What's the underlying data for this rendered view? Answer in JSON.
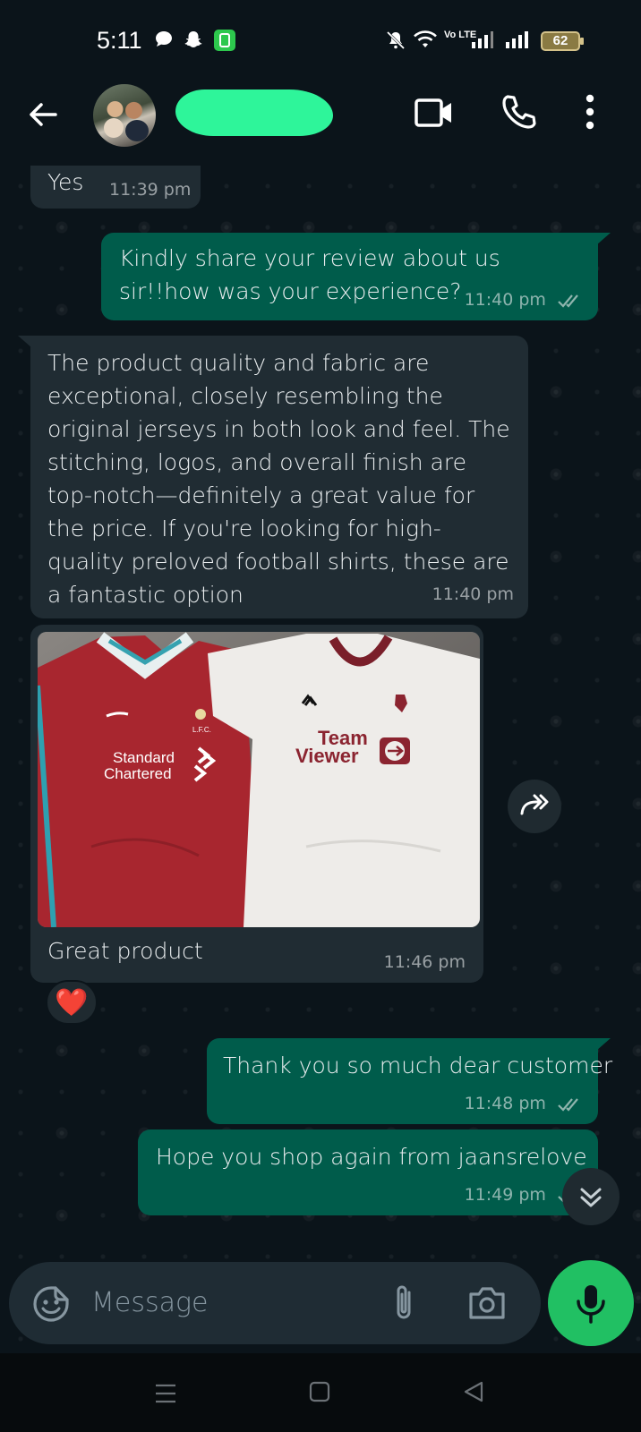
{
  "status_bar": {
    "time": "5:11",
    "battery": "62",
    "network_label": "Vo LTE"
  },
  "header": {
    "contact_name_redacted": true,
    "icons": [
      "back-arrow-icon",
      "video-call-icon",
      "voice-call-icon",
      "more-options-icon"
    ]
  },
  "messages": [
    {
      "direction": "incoming",
      "text": "Yes",
      "time": "11:39 pm"
    },
    {
      "direction": "outgoing",
      "text": "Kindly share your review about us sir!!how was your experience?",
      "time": "11:40 pm",
      "status": "read"
    },
    {
      "direction": "incoming",
      "text": "The product quality and fabric are exceptional, closely resembling the original jerseys in both look and feel. The stitching, logos, and overall finish are top-notch—definitely a great value for the price. If you're looking for high-quality preloved football shirts, these are a fantastic option",
      "time": "11:40 pm"
    },
    {
      "direction": "incoming",
      "type": "image",
      "caption": "Great product",
      "time": "11:46 pm",
      "reaction": "❤️",
      "image_text": {
        "left_shirt": "Standard Chartered",
        "left_badge": "LFC",
        "right_shirt": "TeamViewer"
      }
    },
    {
      "direction": "outgoing",
      "text": "Thank you so much dear customer",
      "time": "11:48 pm",
      "status": "read"
    },
    {
      "direction": "outgoing",
      "text": "Hope you shop again from jaansrelove",
      "time": "11:49 pm",
      "status": "read"
    }
  ],
  "composer": {
    "placeholder": "Message"
  },
  "colors": {
    "background": "#0b141a",
    "incoming_bubble": "#202c33",
    "outgoing_bubble": "#005c4b",
    "accent_green": "#21c063",
    "read_ticks": "#8fb4ad",
    "name_redaction": "#2ef59a"
  }
}
